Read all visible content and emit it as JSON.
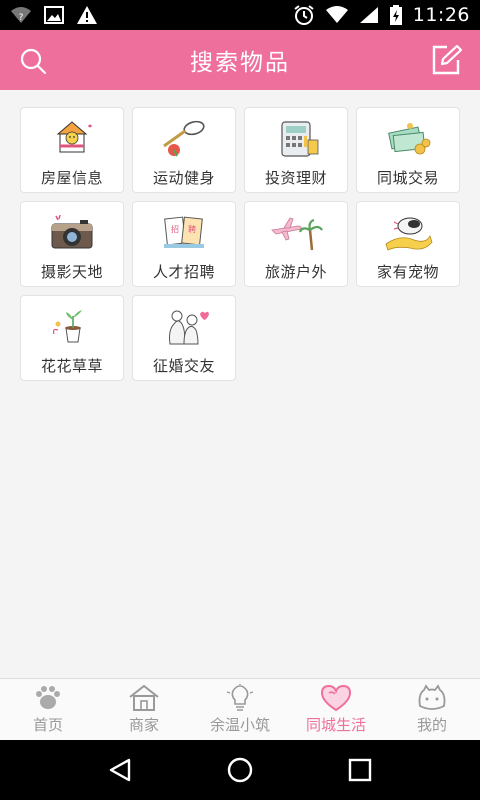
{
  "status_bar": {
    "time": "11:26",
    "icons": [
      "wifi-unknown-icon",
      "image-icon",
      "warning-icon",
      "alarm-icon",
      "wifi-icon",
      "signal-icon",
      "battery-charging-icon"
    ]
  },
  "header": {
    "title": "搜索物品",
    "left_icon": "search-icon",
    "right_icon": "edit-icon",
    "color": "#ef6f9c"
  },
  "categories": [
    {
      "label": "房屋信息",
      "icon": "house-icon"
    },
    {
      "label": "运动健身",
      "icon": "badminton-icon"
    },
    {
      "label": "投资理财",
      "icon": "calculator-icon"
    },
    {
      "label": "同城交易",
      "icon": "money-icon"
    },
    {
      "label": "摄影天地",
      "icon": "camera-icon"
    },
    {
      "label": "人才招聘",
      "icon": "recruit-icon"
    },
    {
      "label": "旅游户外",
      "icon": "airplane-palm-icon"
    },
    {
      "label": "家有宠物",
      "icon": "pet-icon"
    },
    {
      "label": "花花草草",
      "icon": "flower-pot-icon"
    },
    {
      "label": "征婚交友",
      "icon": "couple-hearts-icon"
    }
  ],
  "tabs": [
    {
      "label": "首页",
      "icon": "paw-icon",
      "active": false
    },
    {
      "label": "商家",
      "icon": "store-icon",
      "active": false
    },
    {
      "label": "余温小筑",
      "icon": "lightbulb-icon",
      "active": false
    },
    {
      "label": "同城生活",
      "icon": "heart-icon",
      "active": true
    },
    {
      "label": "我的",
      "icon": "cat-face-icon",
      "active": false
    }
  ],
  "accent_color": "#ef6f9c"
}
